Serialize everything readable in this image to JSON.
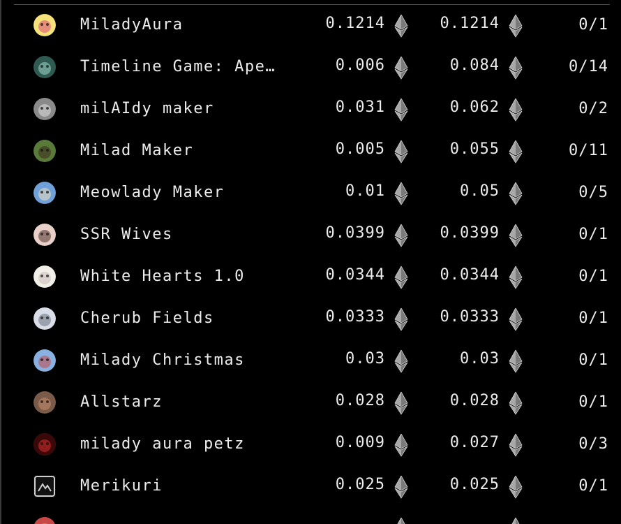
{
  "rows": [
    {
      "name": "MiladyAura",
      "price": "0.1214",
      "total": "0.1214",
      "count": "0/1",
      "avatar_color": "#f6e27a",
      "avatar_accent": "#d94a7a"
    },
    {
      "name": "Timeline Game: Ape…",
      "price": "0.006",
      "total": "0.084",
      "count": "0/14",
      "avatar_color": "#2f5a52",
      "avatar_accent": "#9fd8c8"
    },
    {
      "name": "milAIdy maker",
      "price": "0.031",
      "total": "0.062",
      "count": "0/2",
      "avatar_color": "#8a8a8a",
      "avatar_accent": "#e0e0e0"
    },
    {
      "name": "Milad Maker",
      "price": "0.005",
      "total": "0.055",
      "count": "0/11",
      "avatar_color": "#5a7a3a",
      "avatar_accent": "#3a2a1a"
    },
    {
      "name": "Meowlady Maker",
      "price": "0.01",
      "total": "0.05",
      "count": "0/5",
      "avatar_color": "#6fa0d8",
      "avatar_accent": "#f0e0c0"
    },
    {
      "name": "SSR Wives",
      "price": "0.0399",
      "total": "0.0399",
      "count": "0/1",
      "avatar_color": "#e8d0c8",
      "avatar_accent": "#4a3028"
    },
    {
      "name": "White Hearts 1.0",
      "price": "0.0344",
      "total": "0.0344",
      "count": "0/1",
      "avatar_color": "#f2eee8",
      "avatar_accent": "#c8c0b8"
    },
    {
      "name": "Cherub Fields",
      "price": "0.0333",
      "total": "0.0333",
      "count": "0/1",
      "avatar_color": "#d8dde8",
      "avatar_accent": "#6a7080"
    },
    {
      "name": "Milady Christmas",
      "price": "0.03",
      "total": "0.03",
      "count": "0/1",
      "avatar_color": "#88b0e0",
      "avatar_accent": "#c84848"
    },
    {
      "name": "Allstarz",
      "price": "0.028",
      "total": "0.028",
      "count": "0/1",
      "avatar_color": "#7a5a48",
      "avatar_accent": "#c89070"
    },
    {
      "name": "milady aura petz",
      "price": "0.009",
      "total": "0.027",
      "count": "0/3",
      "avatar_color": "#3a0808",
      "avatar_accent": "#d83030"
    },
    {
      "name": "Merikuri",
      "price": "0.025",
      "total": "0.025",
      "count": "0/1",
      "avatar_color": "#111111",
      "avatar_accent": "#cfcfcf",
      "avatar_shape": "square"
    }
  ],
  "partial_row": {
    "avatar_color": "#c84848"
  },
  "colors": {
    "background": "#000000",
    "text": "#ececec",
    "eth_icon": "#9a9a9a",
    "divider": "#4a4a4a"
  },
  "icons": {
    "currency": "ethereum-icon"
  }
}
